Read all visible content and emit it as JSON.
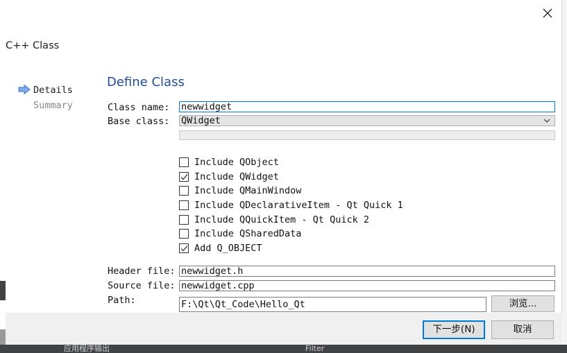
{
  "dialog": {
    "title": "C++ Class",
    "close_icon": "close-icon"
  },
  "steps": [
    {
      "label": "Details",
      "active": true
    },
    {
      "label": "Summary",
      "active": false
    }
  ],
  "page_title": "Define Class",
  "form": {
    "class_name_label": "Class name:",
    "class_name_value": "newwidget",
    "base_class_label": "Base class:",
    "base_class_value": "QWidget",
    "header_file_label": "Header file:",
    "header_file_value": "newwidget.h",
    "source_file_label": "Source file:",
    "source_file_value": "newwidget.cpp",
    "path_label": "Path:",
    "path_value": "F:\\Qt\\Qt_Code\\Hello_Qt",
    "browse_label": "浏览..."
  },
  "checkboxes": [
    {
      "label": "Include QObject",
      "checked": false
    },
    {
      "label": "Include QWidget",
      "checked": true
    },
    {
      "label": "Include QMainWindow",
      "checked": false
    },
    {
      "label": "Include QDeclarativeItem - Qt Quick 1",
      "checked": false
    },
    {
      "label": "Include QQuickItem - Qt Quick 2",
      "checked": false
    },
    {
      "label": "Include QSharedData",
      "checked": false
    },
    {
      "label": "Add Q_OBJECT",
      "checked": true
    }
  ],
  "footer": {
    "next_label": "下一步(N)",
    "cancel_label": "取消"
  },
  "background": {
    "panel_text": "应用程序输出",
    "filter_text": "Filter"
  },
  "colors": {
    "accent": "#0078d7",
    "title_blue": "#1f4e97",
    "step_arrow": "#3a7bd5"
  }
}
